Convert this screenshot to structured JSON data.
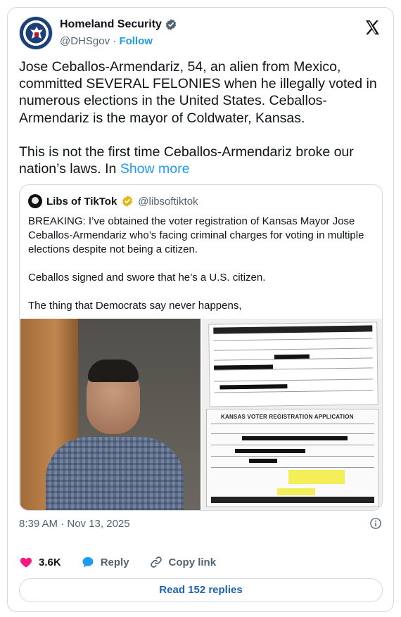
{
  "author": {
    "name": "Homeland Security",
    "handle": "@DHSgov",
    "separator": "·",
    "follow_label": "Follow"
  },
  "tweet": {
    "paragraph1": "Jose Ceballos-Armendariz, 54, an alien from Mexico, committed SEVERAL FELONIES when he illegally voted in numerous elections in the United States. Ceballos-Armendariz is the mayor of Coldwater, Kansas.",
    "paragraph2": "This is not the first time Ceballos-Armendariz broke our nation’s laws. In",
    "show_more": "Show more"
  },
  "quote": {
    "name": "Libs of TikTok",
    "handle": "@libsoftiktok",
    "paragraph1": "BREAKING: I’ve obtained the voter registration of Kansas Mayor Jose Ceballos-Armendariz who’s facing criminal charges for voting in multiple elections despite not being a citizen.",
    "paragraph2": "Ceballos signed and swore that he’s a U.S. citizen.",
    "paragraph3": "The thing that Democrats say never happens,",
    "doc_title": "KANSAS VOTER REGISTRATION APPLICATION"
  },
  "meta": {
    "timestamp": "8:39 AM · Nov 13, 2025"
  },
  "actions": {
    "likes": "3.6K",
    "reply_label": "Reply",
    "copy_link_label": "Copy link"
  },
  "read_replies_label": "Read 152 replies",
  "colors": {
    "accent": "#1d9bf0",
    "verified_blue": "#1d9bf0",
    "verified_gold": "#e2b719",
    "like_red": "#f91880",
    "text_secondary": "#536471"
  },
  "icons": [
    "dhs-seal-avatar",
    "verified-badge-icon",
    "x-logo-icon",
    "gold-verified-badge-icon",
    "info-icon",
    "heart-icon",
    "reply-bubble-icon",
    "link-icon"
  ]
}
